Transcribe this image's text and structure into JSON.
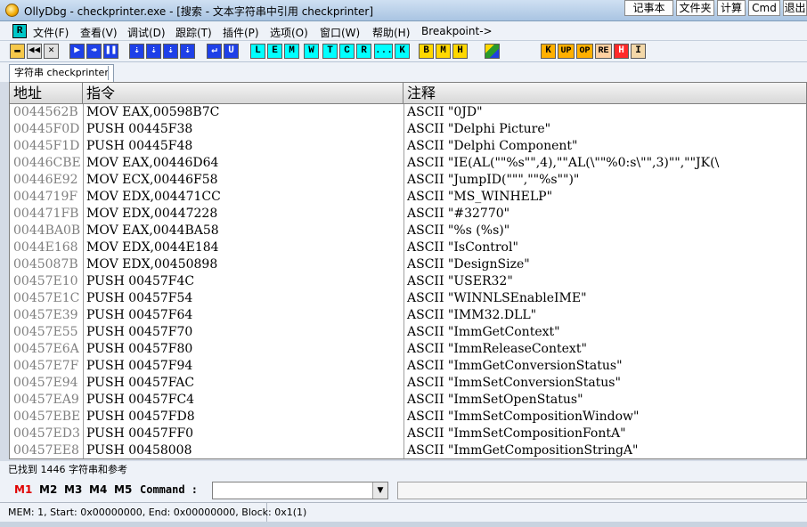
{
  "window": {
    "title": "OllyDbg - checkprinter.exe - [搜索 - 文本字符串中引用 checkprinter]"
  },
  "taskbar_buttons": [
    "记事本",
    "文件夹",
    "计算",
    "Cmd",
    "退出"
  ],
  "menu": {
    "r_icon": "R",
    "items": [
      "文件(F)",
      "查看(V)",
      "调试(D)",
      "跟踪(T)",
      "插件(P)",
      "选项(O)",
      "窗口(W)",
      "帮助(H)",
      "Breakpoint->"
    ]
  },
  "toolbar": {
    "playback": [
      "▶",
      "↠",
      "❚❚"
    ],
    "step": [
      "⇣",
      "⇣",
      "⇣",
      "⇣"
    ],
    "misc": [
      "↵",
      "U"
    ],
    "windows": [
      "L",
      "E",
      "M",
      "W",
      "T",
      "C",
      "R",
      "...",
      "K"
    ],
    "bmh": [
      "B",
      "M",
      "H"
    ],
    "right": [
      "K",
      "UP",
      "OP",
      "RE",
      "H",
      "I"
    ]
  },
  "tab": {
    "label": "字符串 checkprinter"
  },
  "table": {
    "columns": [
      "地址",
      "指令",
      "注释"
    ],
    "rows": [
      {
        "addr": "0044562B",
        "ins": "MOV EAX,00598B7C",
        "comment": "ASCII \"0JD\""
      },
      {
        "addr": "00445F0D",
        "ins": "PUSH 00445F38",
        "comment": "ASCII \"Delphi Picture\""
      },
      {
        "addr": "00445F1D",
        "ins": "PUSH 00445F48",
        "comment": "ASCII \"Delphi Component\""
      },
      {
        "addr": "00446CBE",
        "ins": "MOV EAX,00446D64",
        "comment": "ASCII \"IE(AL(\"\"%s\"\",4),\"\"AL(\\\"\"%0:s\\\"\",3)\"\",\"\"JK(\\"
      },
      {
        "addr": "00446E92",
        "ins": "MOV ECX,00446F58",
        "comment": "ASCII \"JumpID(\"\"\",\"\"%s\"\")\""
      },
      {
        "addr": "0044719F",
        "ins": "MOV EDX,004471CC",
        "comment": "ASCII \"MS_WINHELP\""
      },
      {
        "addr": "004471FB",
        "ins": "MOV EDX,00447228",
        "comment": "ASCII \"#32770\""
      },
      {
        "addr": "0044BA0B",
        "ins": "MOV EAX,0044BA58",
        "comment": "ASCII \"%s (%s)\""
      },
      {
        "addr": "0044E168",
        "ins": "MOV EDX,0044E184",
        "comment": "ASCII \"IsControl\""
      },
      {
        "addr": "0045087B",
        "ins": "MOV EDX,00450898",
        "comment": "ASCII \"DesignSize\""
      },
      {
        "addr": "00457E10",
        "ins": "PUSH 00457F4C",
        "comment": "ASCII \"USER32\""
      },
      {
        "addr": "00457E1C",
        "ins": "PUSH 00457F54",
        "comment": "ASCII \"WINNLSEnableIME\""
      },
      {
        "addr": "00457E39",
        "ins": "PUSH 00457F64",
        "comment": "ASCII \"IMM32.DLL\""
      },
      {
        "addr": "00457E55",
        "ins": "PUSH 00457F70",
        "comment": "ASCII \"ImmGetContext\""
      },
      {
        "addr": "00457E6A",
        "ins": "PUSH 00457F80",
        "comment": "ASCII \"ImmReleaseContext\""
      },
      {
        "addr": "00457E7F",
        "ins": "PUSH 00457F94",
        "comment": "ASCII \"ImmGetConversionStatus\""
      },
      {
        "addr": "00457E94",
        "ins": "PUSH 00457FAC",
        "comment": "ASCII \"ImmSetConversionStatus\""
      },
      {
        "addr": "00457EA9",
        "ins": "PUSH 00457FC4",
        "comment": "ASCII \"ImmSetOpenStatus\""
      },
      {
        "addr": "00457EBE",
        "ins": "PUSH 00457FD8",
        "comment": "ASCII \"ImmSetCompositionWindow\""
      },
      {
        "addr": "00457ED3",
        "ins": "PUSH 00457FF0",
        "comment": "ASCII \"ImmSetCompositionFontA\""
      },
      {
        "addr": "00457EE8",
        "ins": "PUSH 00458008",
        "comment": "ASCII \"ImmGetCompositionStringA\""
      }
    ]
  },
  "status": {
    "found": "已找到 1446 字符串和参考",
    "memory": "MEM: 1, Start: 0x00000000, End: 0x00000000, Block: 0x1(1)"
  },
  "command_bar": {
    "m_buttons": [
      "M1",
      "M2",
      "M3",
      "M4",
      "M5"
    ],
    "label": "Command :",
    "value": "",
    "dropdown_glyph": "▼"
  },
  "colors": {
    "address_text": "#808080",
    "m1_active": "#e00000",
    "titlebar": "#a9c4e2"
  }
}
